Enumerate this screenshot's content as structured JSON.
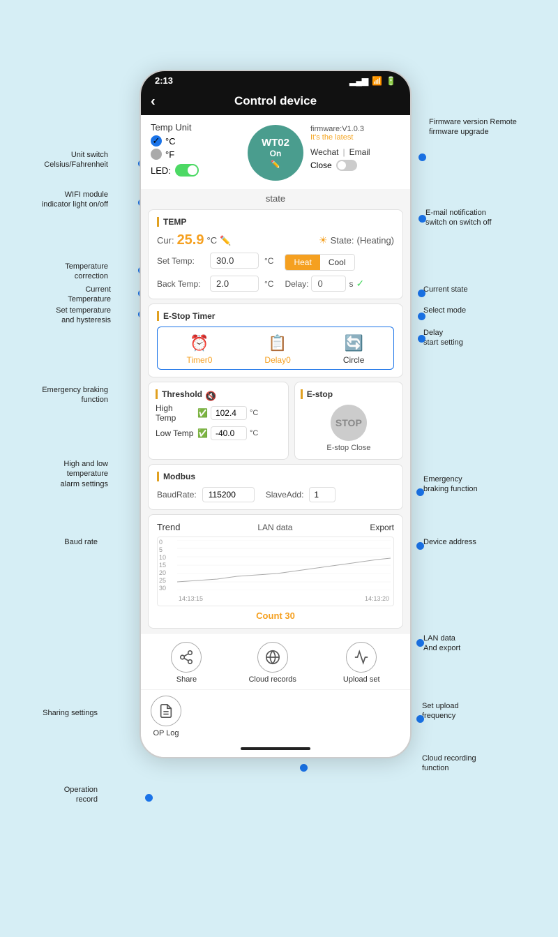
{
  "app": {
    "title": "Control device",
    "status_time": "2:13",
    "back_label": "‹"
  },
  "annotations": {
    "firmware_version": "Firmware version\nRemote firmware\nupgrade",
    "unit_switch": "Unit switch\nCelsius/Fahrenheit",
    "wifi_module": "WIFI module\nindicator light on/off",
    "email_notification": "E-mail notification\nswitch on switch off",
    "temperature_correction": "Temperature\ncorrection",
    "current_temperature": "Current\nTemperature",
    "set_temperature": "Set temperature\nand hysteresis",
    "current_state": "Current state",
    "select_mode": "Select mode",
    "delay_start": "Delay\nstart setting",
    "emergency_braking": "Emergency braking\nfunction",
    "high_low_alarm": "High and low\ntemperature\nalarm settings",
    "estop_function": "Emergency\nbraking function",
    "baud_rate": "Baud rate",
    "device_address": "Device address",
    "lan_export": "LAN data\nAnd export",
    "sharing": "Sharing settings",
    "upload_freq": "Set upload\nfrequency",
    "cloud_recording": "Cloud recording\nfunction",
    "op_record": "Operation\nrecord"
  },
  "device_panel": {
    "temp_unit_label": "Temp Unit",
    "celsius": "°C",
    "fahrenheit": "°F",
    "led_label": "LED:",
    "firmware_text": "firmware:V1.0.3",
    "firmware_status": "It's the latest",
    "device_name": "WT02",
    "device_status": "On",
    "notify_wechat": "Wechat",
    "notify_divider": "|",
    "notify_email": "Email",
    "notify_close": "Close"
  },
  "state_section": {
    "state_label": "state"
  },
  "temp_card": {
    "title": "TEMP",
    "cur_label": "Cur:",
    "cur_value": "25.9",
    "cur_unit": "°C",
    "state_label": "State:",
    "state_value": "(Heating)",
    "set_temp_label": "Set Temp:",
    "set_temp_value": "30.0",
    "set_unit": "°C",
    "back_temp_label": "Back Temp:",
    "back_temp_value": "2.0",
    "back_unit": "°C",
    "mode_heat": "Heat",
    "mode_cool": "Cool",
    "delay_label": "Delay:",
    "delay_value": "0",
    "delay_unit": "s"
  },
  "estop_card": {
    "title": "E-Stop Timer",
    "timer_label": "Timer",
    "timer_value": "0",
    "delay_label": "Delay",
    "delay_value": "0",
    "circle_label": "Circle"
  },
  "threshold_card": {
    "title": "Threshold",
    "high_label": "High Temp",
    "high_value": "102.4",
    "high_unit": "°C",
    "low_label": "Low Temp",
    "low_value": "-40.0",
    "low_unit": "°C"
  },
  "estop_section": {
    "title": "E-stop",
    "stop_label": "STOP",
    "close_label": "E-stop Close"
  },
  "modbus_card": {
    "title": "Modbus",
    "baud_label": "BaudRate:",
    "baud_value": "115200",
    "slave_label": "SlaveAdd:",
    "slave_value": "1"
  },
  "trend_card": {
    "title": "Trend",
    "lan_label": "LAN data",
    "export_label": "Export",
    "y_labels": [
      "0",
      "5",
      "10",
      "15",
      "20",
      "25",
      "30"
    ],
    "x_label_left": "14:13:15",
    "x_label_right": "14:13:20",
    "count_label": "Count",
    "count_value": "30"
  },
  "bottom_icons": {
    "share_label": "Share",
    "cloud_label": "Cloud records",
    "upload_label": "Upload set",
    "oplog_label": "OP Log"
  }
}
